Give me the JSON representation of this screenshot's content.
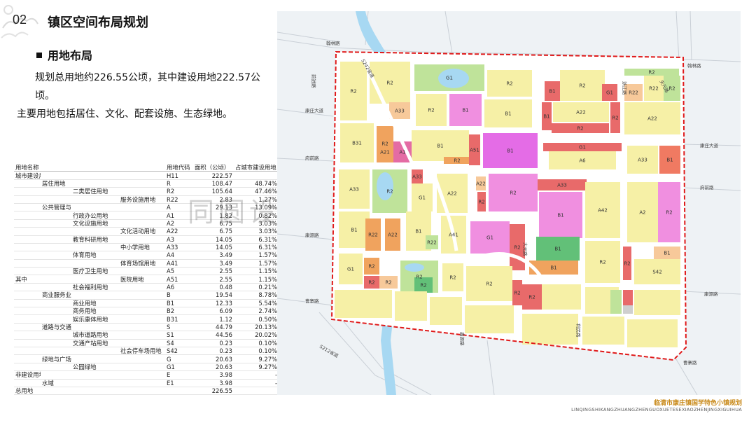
{
  "header": {
    "section_number": "02",
    "section_title": "镇区空间布局规划",
    "subtitle": "用地布局",
    "intro_line1": "规划总用地约226.55公顷，其中建设用地222.57公顷。",
    "intro_line2": "主要用地包括居住、文化、配套设施、生态绿地。"
  },
  "table": {
    "headers": [
      "用地名称",
      "",
      "",
      "",
      "用地代码",
      "面积（公顷）",
      "占城市建设用地"
    ],
    "rows": [
      [
        "城市建设用地",
        "",
        "",
        "",
        "H11",
        "222.57",
        ""
      ],
      [
        "",
        "居住用地",
        "",
        "",
        "R",
        "108.47",
        "48.74%"
      ],
      [
        "",
        "",
        "二类居住用地",
        "",
        "R2",
        "105.64",
        "47.46%"
      ],
      [
        "",
        "",
        "",
        "服务设施用地",
        "R22",
        "2.83",
        "1.27%"
      ],
      [
        "",
        "公共管理与公共服务用地",
        "",
        "",
        "A",
        "29.13",
        "13.09%"
      ],
      [
        "",
        "",
        "行政办公用地",
        "",
        "A1",
        "1.82",
        "0.82%"
      ],
      [
        "",
        "",
        "文化设施用地",
        "",
        "A2",
        "6.75",
        "3.03%"
      ],
      [
        "",
        "",
        "",
        "文化活动用地",
        "A22",
        "6.75",
        "3.03%"
      ],
      [
        "",
        "",
        "教育科研用地",
        "",
        "A3",
        "14.05",
        "6.31%"
      ],
      [
        "",
        "",
        "",
        "中小学用地",
        "A33",
        "14.05",
        "6.31%"
      ],
      [
        "",
        "",
        "体育用地",
        "",
        "A4",
        "3.49",
        "1.57%"
      ],
      [
        "",
        "",
        "",
        "体育场馆用地",
        "A41",
        "3.49",
        "1.57%"
      ],
      [
        "",
        "",
        "医疗卫生用地",
        "",
        "A5",
        "2.55",
        "1.15%"
      ],
      [
        "其中",
        "",
        "",
        "医院用地",
        "A51",
        "2.55",
        "1.15%"
      ],
      [
        "",
        "",
        "社会福利用地",
        "",
        "A6",
        "0.48",
        "0.21%"
      ],
      [
        "",
        "商业服务业设施用地",
        "",
        "",
        "B",
        "19.54",
        "8.78%"
      ],
      [
        "",
        "",
        "商业用地",
        "",
        "B1",
        "12.33",
        "5.54%"
      ],
      [
        "",
        "",
        "商务用地",
        "",
        "B2",
        "6.09",
        "2.74%"
      ],
      [
        "",
        "",
        "娱乐康体用地",
        "",
        "B31",
        "1.12",
        "0.50%"
      ],
      [
        "",
        "道路与交通设施用地",
        "",
        "",
        "S",
        "44.79",
        "20.13%"
      ],
      [
        "",
        "",
        "城市道路用地",
        "",
        "S1",
        "44.56",
        "20.02%"
      ],
      [
        "",
        "",
        "交通产站用地",
        "",
        "S4",
        "0.23",
        "0.10%"
      ],
      [
        "",
        "",
        "",
        "社会停车场用地",
        "S42",
        "0.23",
        "0.10%"
      ],
      [
        "",
        "绿地与广场用地",
        "",
        "",
        "G",
        "20.63",
        "9.27%"
      ],
      [
        "",
        "",
        "公园绿地",
        "",
        "G1",
        "20.63",
        "9.27%"
      ],
      [
        "非建设用地",
        "",
        "",
        "",
        "E",
        "3.98",
        "-"
      ],
      [
        "",
        "水域",
        "",
        "",
        "E1",
        "3.98",
        "-"
      ],
      [
        "总用地",
        "",
        "",
        "",
        "",
        "226.55",
        ""
      ]
    ]
  },
  "watermark": "同圆设计集团有限公司",
  "map": {
    "colors": {
      "residential": "#f6f0a6",
      "service_r22": "#f7c99a",
      "culture": "#f0a35e",
      "school": "#f08fe0",
      "admin": "#e46ce6",
      "commercial": "#e86a6a",
      "hospital": "#f07a62",
      "green": "#bfe39a",
      "sport": "#62c078",
      "water": "#a7d8f2",
      "road": "#ffffff",
      "boundary": "#e01a1a",
      "outside": "#eef2f5"
    },
    "road_labels": [
      "翰林路",
      "翰林路",
      "康庄大道",
      "康庄大道",
      "府前路",
      "府前路",
      "康源路",
      "康源路",
      "曹寨路",
      "曹寨路",
      "前进路",
      "天元路",
      "浙江路",
      "S242省道",
      "S212省道",
      "鑫源路",
      "大元路",
      "利民路"
    ],
    "parcels": [
      "R2",
      "R2",
      "G1",
      "R2",
      "B1",
      "R2",
      "G1",
      "R2",
      "R22",
      "R22",
      "R2",
      "A33",
      "R2",
      "B1",
      "B1",
      "B1",
      "R2",
      "R2",
      "A22",
      "A22",
      "B31",
      "R2",
      "A21",
      "A1",
      "B1",
      "R2",
      "A51",
      "B1",
      "G1",
      "A6",
      "A33",
      "B1",
      "A33",
      "R2",
      "A33",
      "G1",
      "A22",
      "A22",
      "R2",
      "R2",
      "A33",
      "B1",
      "A42",
      "A2",
      "R2",
      "B1",
      "R22",
      "A22",
      "B1",
      "R22",
      "A41",
      "G1",
      "R2",
      "B1",
      "B1",
      "R2",
      "R2",
      "B1",
      "S42",
      "G1",
      "R2",
      "R2",
      "R2",
      "R2",
      "R2",
      "R2",
      "R2",
      "R2",
      "R2"
    ]
  },
  "footer": {
    "brand": "临清市康庄镇国学特色小镇规划",
    "pinyin": "LINQINGSHIKANGZHUANGZHENGUOXUETESEXIAOZHENJINGXIGUIHUA"
  }
}
